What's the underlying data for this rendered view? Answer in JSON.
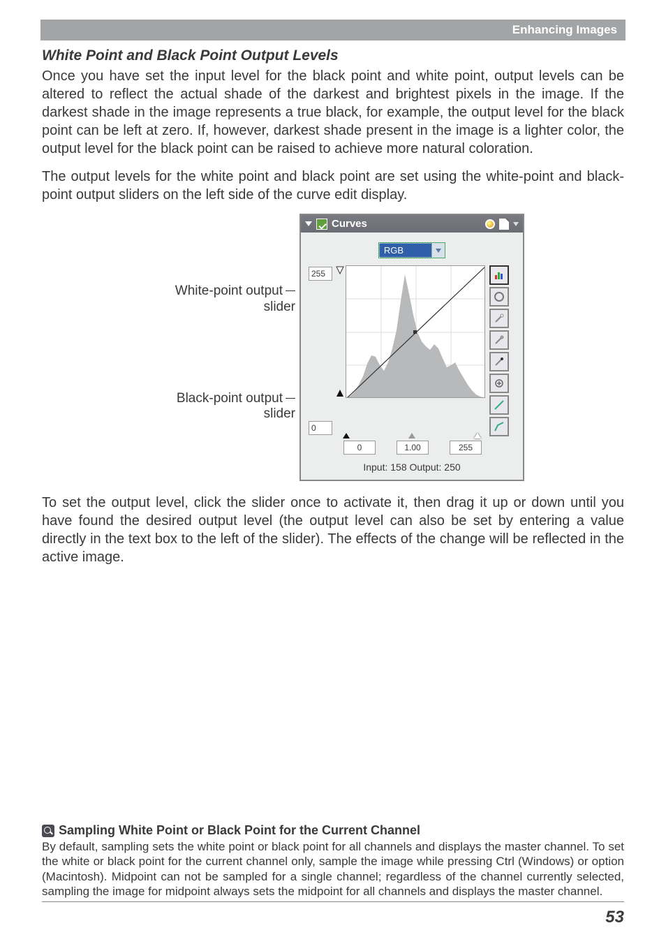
{
  "header": {
    "section": "Enhancing Images"
  },
  "title": "White Point and Black Point Output Levels",
  "para1": "Once you have set the input level for the black point and white point, output levels can be altered to reflect the actual shade of the darkest and brightest pixels in the image.  If the darkest shade in the image represents a true black, for example, the output level for the black point can be left at zero.  If, however, darkest shade present in the image is a lighter color, the output level for the black point can be raised to achieve more natural coloration.",
  "para2": "The output levels for the white point and black point are set using the white-point and black-point output sliders on the left side of the curve edit display.",
  "labels": {
    "white_a": "White-point output",
    "white_b": "slider",
    "black_a": "Black-point output",
    "black_b": "slider"
  },
  "panel": {
    "title": "Curves",
    "channel": "RGB",
    "out_max": "255",
    "out_min": "0",
    "in_min": "0",
    "in_mid": "1.00",
    "in_max": "255",
    "readout": "Input: 158  Output: 250"
  },
  "para3": "To set the output level, click the slider once to activate it, then drag it up or down until you have found the desired output level (the output level can also be set by entering a value directly in the text box to the left of the slider).  The effects of the change will be reflected in the active image.",
  "note": {
    "title": "Sampling White Point or Black Point for the Current Channel",
    "body": "By default, sampling sets the white point or black point for all channels and displays the master channel.  To set the white or black point for the current channel only, sample the image while pressing Ctrl (Windows) or option (Macintosh).  Midpoint can not be sampled for a single channel; regardless of the channel currently selected, sampling the image for midpoint always sets the midpoint for all channels and displays the master channel."
  },
  "chart_data": {
    "type": "line",
    "title": "Curves",
    "xlabel": "Input",
    "ylabel": "Output",
    "xlim": [
      0,
      255
    ],
    "ylim": [
      0,
      255
    ],
    "series": [
      {
        "name": "tone-curve",
        "x": [
          0,
          255
        ],
        "y": [
          0,
          255
        ]
      }
    ],
    "histogram": {
      "bins": [
        0,
        8,
        16,
        24,
        32,
        40,
        48,
        56,
        64,
        72,
        80,
        88,
        96,
        104,
        112,
        120,
        128,
        136,
        144,
        152,
        160,
        168,
        176,
        184,
        192,
        200,
        208,
        216,
        224,
        232,
        240,
        248,
        255
      ],
      "counts": [
        2,
        5,
        12,
        28,
        40,
        58,
        62,
        48,
        40,
        55,
        78,
        110,
        170,
        230,
        200,
        150,
        115,
        100,
        92,
        85,
        95,
        88,
        65,
        48,
        52,
        58,
        40,
        28,
        18,
        10,
        5,
        2,
        1
      ]
    },
    "input_sliders": {
      "black": 0,
      "mid": 1.0,
      "white": 255
    },
    "output_sliders": {
      "black": 0,
      "white": 255
    },
    "readout": {
      "input": 158,
      "output": 250
    }
  },
  "page_number": "53"
}
